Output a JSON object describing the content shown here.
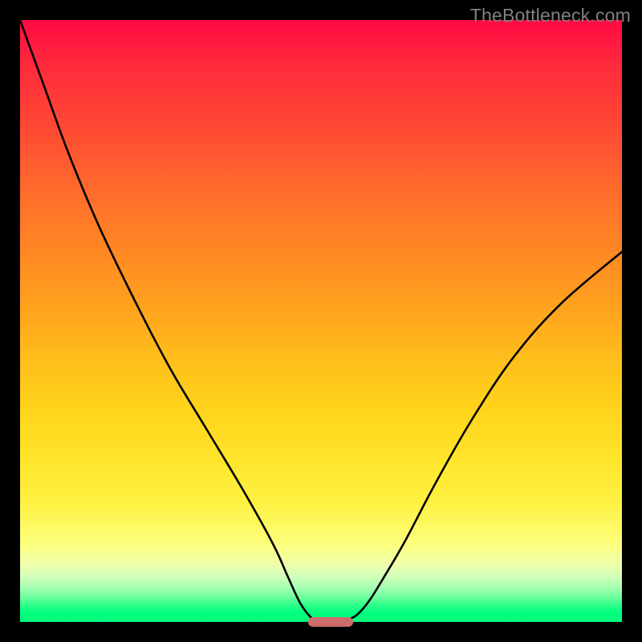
{
  "watermark": "TheBottleneck.com",
  "chart_data": {
    "type": "line",
    "title": "",
    "xlabel": "",
    "ylabel": "",
    "xlim": [
      0,
      100
    ],
    "ylim": [
      0,
      100
    ],
    "grid": false,
    "series": [
      {
        "name": "left-branch",
        "x": [
          0,
          4,
          8,
          13,
          19,
          25,
          31,
          37,
          42,
          44.5,
          46.5,
          48,
          48.8
        ],
        "y": [
          100,
          89,
          78,
          66,
          53.5,
          42,
          32,
          22,
          13,
          7.5,
          3.2,
          1.1,
          0.4
        ]
      },
      {
        "name": "right-branch",
        "x": [
          54.5,
          56,
          58,
          60.5,
          64,
          69,
          75,
          82,
          90,
          100
        ],
        "y": [
          0.4,
          1.2,
          3.5,
          7.5,
          13.5,
          23,
          33.5,
          44,
          53,
          61.5
        ]
      }
    ],
    "marker": {
      "name": "optimum-indicator",
      "x_center": 51.6,
      "y_center": 0.0,
      "width": 7.5,
      "height": 1.6,
      "color": "#cc6d6b"
    },
    "colors": {
      "curve": "#000000",
      "gradient_top": "#ff0a43",
      "gradient_bottom": "#00fb7d",
      "marker": "#cc6d6b",
      "frame": "#000000"
    }
  }
}
